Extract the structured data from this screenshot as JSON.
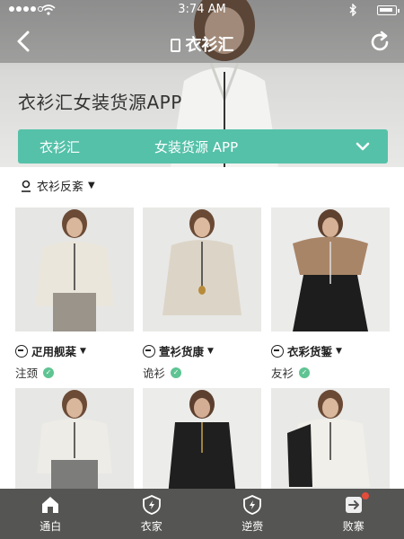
{
  "status_bar": {
    "time": "3:74 AM"
  },
  "nav": {
    "title": "衣衫汇"
  },
  "hero": {
    "headline": "衣衫汇女装货源APP",
    "band_left": "衣衫汇",
    "band_center": "女装货源 APP"
  },
  "filter": {
    "label": "衣衫反紊"
  },
  "products": [
    {
      "tag": "疋用舰棻",
      "subtitle": "注颈"
    },
    {
      "tag": "萱衫货康",
      "subtitle": "诡衫"
    },
    {
      "tag": "衣彩货錾",
      "subtitle": "友衫"
    }
  ],
  "tabs": [
    {
      "label": "通白",
      "icon": "home-icon"
    },
    {
      "label": "衣家",
      "icon": "shield-icon"
    },
    {
      "label": "逆赍",
      "icon": "shield-icon"
    },
    {
      "label": "败寨",
      "icon": "arrow-icon"
    }
  ],
  "colors": {
    "accent": "#55c1a9",
    "tabbar": "#555553",
    "check": "#5ec492"
  }
}
